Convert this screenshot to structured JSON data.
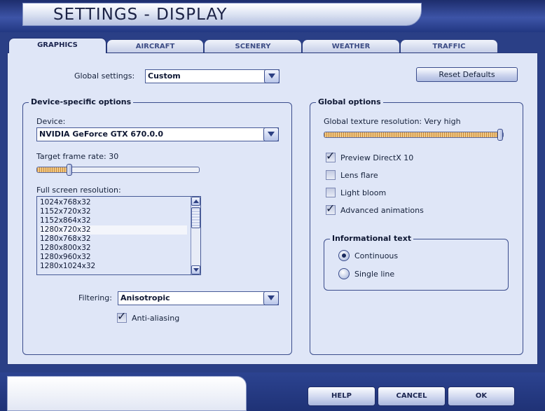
{
  "window": {
    "title": "SETTINGS - DISPLAY"
  },
  "tabs": [
    {
      "label": "GRAPHICS",
      "active": true
    },
    {
      "label": "AIRCRAFT",
      "active": false
    },
    {
      "label": "SCENERY",
      "active": false
    },
    {
      "label": "WEATHER",
      "active": false
    },
    {
      "label": "TRAFFIC",
      "active": false
    }
  ],
  "global_settings": {
    "label": "Global settings:",
    "value": "Custom"
  },
  "reset_defaults": {
    "label": "Reset Defaults"
  },
  "device_options": {
    "legend": "Device-specific options",
    "device_label": "Device:",
    "device_value": "NVIDIA GeForce GTX 670.0.0",
    "frame_rate_label": "Target frame rate: 30",
    "frame_rate_level": 0.19,
    "resolution_label": "Full screen resolution:",
    "resolutions": [
      "1024x768x32",
      "1152x720x32",
      "1152x864x32",
      "1280x720x32",
      "1280x768x32",
      "1280x800x32",
      "1280x960x32",
      "1280x1024x32"
    ],
    "selected_resolution": "1280x720x32",
    "filtering_label": "Filtering:",
    "filtering_value": "Anisotropic",
    "anti_aliasing_label": "Anti-aliasing",
    "anti_aliasing_checked": true
  },
  "global_options": {
    "legend": "Global options",
    "texture_label": "Global texture resolution: Very high",
    "texture_level": 1.0,
    "checkboxes": [
      {
        "label": "Preview DirectX 10",
        "checked": true
      },
      {
        "label": "Lens flare",
        "checked": false
      },
      {
        "label": "Light bloom",
        "checked": false
      },
      {
        "label": "Advanced animations",
        "checked": true
      }
    ]
  },
  "informational_text": {
    "legend": "Informational text",
    "options": [
      {
        "label": "Continuous",
        "selected": true
      },
      {
        "label": "Single line",
        "selected": false
      }
    ]
  },
  "footer": {
    "help_label": "HELP",
    "cancel_label": "CANCEL",
    "ok_label": "OK"
  },
  "colors": {
    "frame_blue": "#2a3f86",
    "panel_bg": "#dfe6f7",
    "slider_fill": "#e8b66a"
  }
}
